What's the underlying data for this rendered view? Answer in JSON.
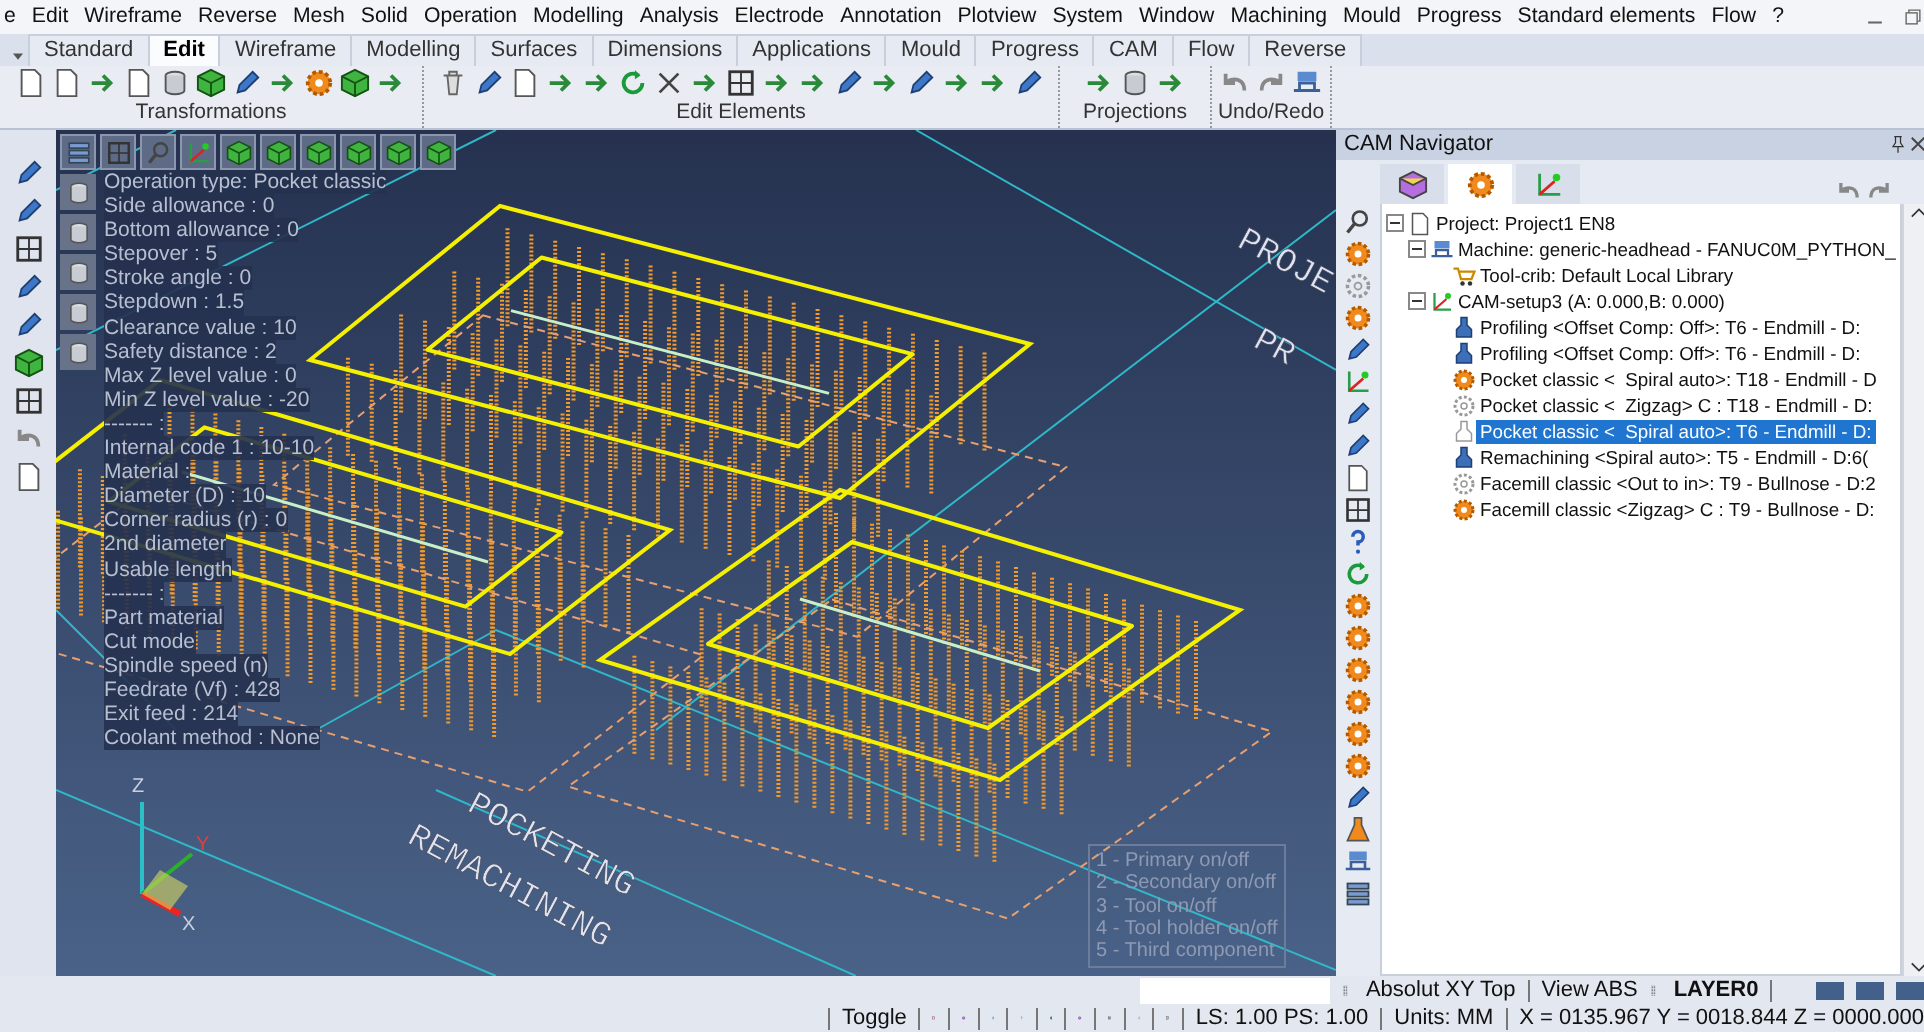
{
  "menu": [
    "e",
    "Edit",
    "Wireframe",
    "Reverse",
    "Mesh",
    "Solid",
    "Operation",
    "Modelling",
    "Analysis",
    "Electrode",
    "Annotation",
    "Plotview",
    "System",
    "Window",
    "Machining",
    "Mould",
    "Progress",
    "Standard elements",
    "Flow",
    "?"
  ],
  "ribbon_tabs": [
    {
      "label": "Standard",
      "selected": false
    },
    {
      "label": "Edit",
      "selected": true
    },
    {
      "label": "Wireframe",
      "selected": false
    },
    {
      "label": "Modelling",
      "selected": false
    },
    {
      "label": "Surfaces",
      "selected": false
    },
    {
      "label": "Dimensions",
      "selected": false
    },
    {
      "label": "Applications",
      "selected": false
    },
    {
      "label": "Mould",
      "selected": false
    },
    {
      "label": "Progress",
      "selected": false
    },
    {
      "label": "CAM",
      "selected": false
    },
    {
      "label": "Flow",
      "selected": false
    },
    {
      "label": "Reverse",
      "selected": false
    }
  ],
  "toolbar_groups": [
    {
      "label": "Transformations"
    },
    {
      "label": "Edit Elements"
    },
    {
      "label": "Projections"
    },
    {
      "label": "Undo/Redo"
    }
  ],
  "viewport": {
    "operation_info": [
      "Operation type: Pocket classic",
      "Side allowance : 0",
      "Bottom allowance : 0",
      "Stepover : 5",
      "Stroke angle : 0",
      "Stepdown : 1.5",
      "Clearance value : 10",
      "Safety distance : 2",
      "Max Z level value : 0",
      "Min Z level value : -20",
      "------- :",
      "Internal code 1 : 10-10",
      "Material :",
      "Diameter (D) : 10",
      "Corner radius (r) : 0",
      "2nd diameter",
      "Usable length",
      "------- :",
      "Part material",
      "Cut mode",
      "Spindle speed (n)",
      "Feedrate (Vf) : 428",
      "Exit feed : 214",
      "Coolant method : None"
    ],
    "labels": [
      {
        "text": "PROJE",
        "kind": "edge"
      },
      {
        "text": "PR",
        "kind": "edge2"
      },
      {
        "text": "POCKETING",
        "kind": "upper"
      },
      {
        "text": "REMACHINING",
        "kind": "lower"
      }
    ],
    "axis_labels": [
      "Z",
      "Y",
      "X"
    ],
    "legend": [
      "1 - Primary on/off",
      "2 - Secondary on/off",
      "3 - Tool on/off",
      "4 - Tool holder on/off",
      "5 - Third component"
    ]
  },
  "cam_navigator": {
    "title": "CAM Navigator",
    "tabs": [
      {
        "selected": false
      },
      {
        "selected": true
      },
      {
        "selected": false
      }
    ],
    "tree": [
      {
        "label": "Project: Project1 EN8",
        "kind": "project",
        "selected": false,
        "expanded": true,
        "children": [
          {
            "label": "Machine: generic-headhead - FANUC0M_PYTHON_",
            "kind": "machine",
            "selected": false,
            "expanded": true,
            "children": [
              {
                "label": "Tool-crib: Default Local Library",
                "kind": "toolcrib",
                "selected": false
              }
            ]
          },
          {
            "label": "CAM-setup3 (A: 0.000,B: 0.000)",
            "kind": "setup",
            "selected": false,
            "expanded": true,
            "children": [
              {
                "label": "Profiling <Offset Comp: Off>: T6 - Endmill - D:",
                "kind": "tool",
                "selected": false
              },
              {
                "label": "Profiling <Offset Comp: Off>: T6 - Endmill - D:",
                "kind": "tool",
                "selected": false
              },
              {
                "label": "Pocket classic <  Spiral auto>: T18 - Endmill - D",
                "kind": "gear",
                "selected": false
              },
              {
                "label": "Pocket classic <  Zigzag> C : T18 - Endmill - D:",
                "kind": "gear-off",
                "selected": false
              },
              {
                "label": "Pocket classic <  Spiral auto>: T6 - Endmill - D:",
                "kind": "tool-off",
                "selected": true
              },
              {
                "label": "Remachining <Spiral auto>: T5 - Endmill - D:6(",
                "kind": "tool",
                "selected": false
              },
              {
                "label": "Facemill classic <Out to in>: T9 - Bullnose - D:2",
                "kind": "gear-off",
                "selected": false
              },
              {
                "label": "Facemill classic <Zigzag> C : T9 - Bullnose - D:",
                "kind": "gear",
                "selected": false
              }
            ]
          }
        ]
      }
    ]
  },
  "status_bar": {
    "view": "Absolut XY Top",
    "view_mode": "View ABS",
    "layer": "LAYER0",
    "toggle": "Toggle",
    "scale": "LS: 1.00 PS: 1.00",
    "units": "Units: MM",
    "coordinates": "X = 0135.967 Y = 0018.844 Z = 0000.000"
  }
}
